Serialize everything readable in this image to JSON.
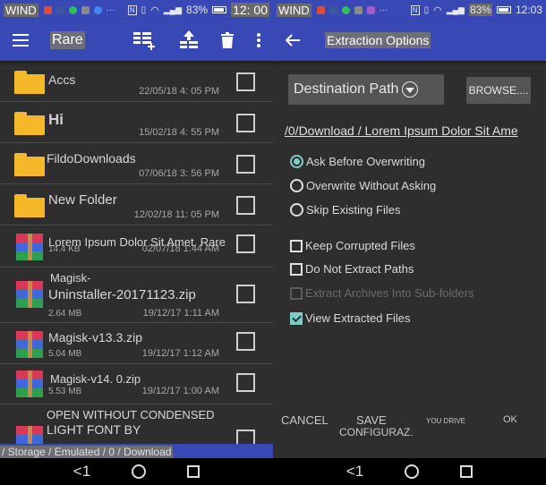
{
  "left_screen": {
    "status_bar": {
      "carrier": "WIND",
      "battery": "83%",
      "time": "12: 00"
    },
    "app_bar": {
      "title": "Rare",
      "icons": [
        "menu-icon",
        "add-archive-icon",
        "extract-icon",
        "delete-icon",
        "more-icon"
      ]
    },
    "files": [
      {
        "name": "Accs",
        "type": "folder",
        "date": "22/05/18 4: 05 PM",
        "checked": false
      },
      {
        "name": "Hi",
        "type": "folder",
        "date": "15/02/18 4: 55 PM",
        "checked": false
      },
      {
        "name": "FildoDownloads",
        "type": "folder",
        "date": "07/06/18 3: 56 PM",
        "checked": false
      },
      {
        "name": "New Folder",
        "type": "folder",
        "date": "12/02/18 11: 05 PM",
        "checked": false
      },
      {
        "name": "Lorem Ipsum Dolor Sit Amet. Rare",
        "type": "archive",
        "size": "14.4 KB",
        "date": "02/07/18 1:44 AM",
        "checked": false
      },
      {
        "name": "Magisk-Uninstaller-20171123.zip",
        "name_line1": "Magisk-",
        "name_line2": "Uninstaller-20171123.zip",
        "type": "archive",
        "size": "2.64 MB",
        "date": "19/12/17 1:11 AM",
        "checked": false
      },
      {
        "name": "Magisk-v13.3.zip",
        "type": "archive",
        "size": "5.04 MB",
        "date": "19/12/17 1:12 AM",
        "checked": false
      },
      {
        "name": "Magisk-v14. 0.zip",
        "type": "archive",
        "size": "5.53 MB",
        "date": "19/12/17 1:00 AM",
        "checked": false
      },
      {
        "name": "OPEN WITHOUT CONDENSED LIGHT FONT BY",
        "name_line1": "OPEN WITHOUT CONDENSED",
        "name_line2": "LIGHT FONT BY",
        "type": "archive",
        "checked": false
      }
    ],
    "path_bar": "/ Storage / Emulated / 0 / Download",
    "nav": {
      "back": "<1"
    }
  },
  "right_screen": {
    "status_bar": {
      "carrier": "WIND",
      "battery": "83%",
      "time": "12:03"
    },
    "app_bar": {
      "title": "Extraction Options",
      "back_icon": "arrow-left-icon"
    },
    "destination_label": "Destination Path",
    "browse_label": "BROWSE....",
    "destination_path": "/0/Download / Lorem Ipsum Dolor Sit Ame",
    "overwrite_options": [
      {
        "label": "Ask Before Overwriting",
        "selected": true
      },
      {
        "label": "Overwrite Without Asking",
        "selected": false
      },
      {
        "label": "Skip Existing Files",
        "selected": false
      }
    ],
    "checkboxes": [
      {
        "label": "Keep Corrupted Files",
        "checked": false,
        "enabled": true
      },
      {
        "label": "Do Not Extract Paths",
        "checked": false,
        "enabled": true
      },
      {
        "label": "Extract Archives Into Sub-folders",
        "checked": false,
        "enabled": false
      },
      {
        "label": "View Extracted Files",
        "checked": true,
        "enabled": true
      }
    ],
    "actions": {
      "cancel": "CANCEL",
      "save_line1": "SAVE",
      "save_line2": "CONFIGURAZ.",
      "you_drive": "YOU DRIVE",
      "ok": "OK"
    },
    "nav": {
      "back": "<1"
    }
  },
  "colors": {
    "accent_blue": "#3848b4",
    "background": "#2e2e2e",
    "teal_check": "#80cbc4",
    "folder_yellow": "#f4b829"
  }
}
